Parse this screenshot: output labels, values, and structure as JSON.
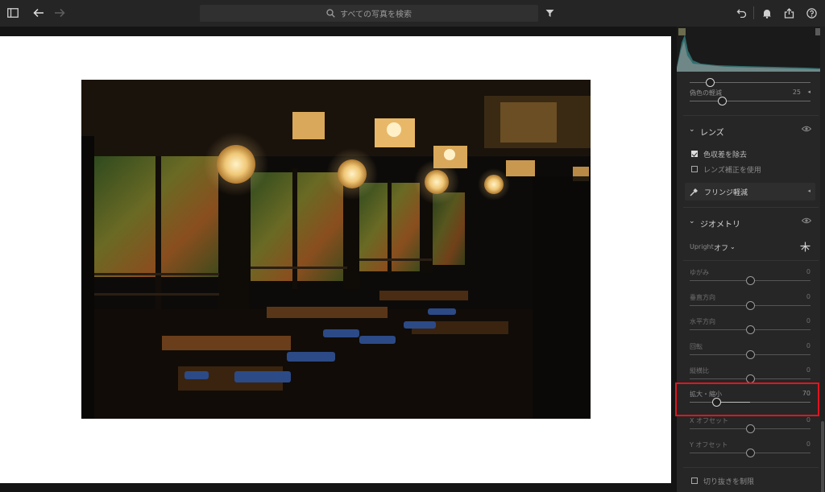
{
  "topbar": {
    "search_placeholder": "すべての写真を検索"
  },
  "panel": {
    "top_slider": {
      "label": "",
      "value": "",
      "level": 0.17
    },
    "defringe_slider": {
      "label": "偽色の軽減",
      "value": "25",
      "level": 0.27
    },
    "lens": {
      "title": "レンズ",
      "remove_ca": {
        "label": "色収差を除去",
        "checked": true
      },
      "enable_profile": {
        "label": "レンズ補正を使用",
        "checked": false
      },
      "fringe_button": {
        "label": "フリンジ軽減"
      }
    },
    "geometry": {
      "title": "ジオメトリ",
      "upright_label": "Upright",
      "upright_value": "オフ",
      "sliders": [
        {
          "label": "ゆがみ",
          "value": "0",
          "level": 0.5
        },
        {
          "label": "垂直方向",
          "value": "0",
          "level": 0.5
        },
        {
          "label": "水平方向",
          "value": "0",
          "level": 0.5
        },
        {
          "label": "回転",
          "value": "0",
          "level": 0.5
        },
        {
          "label": "縦横比",
          "value": "0",
          "level": 0.5
        },
        {
          "label": "拡大・縮小",
          "value": "70",
          "level": 0.22
        },
        {
          "label": "X オフセット",
          "value": "0",
          "level": 0.5
        },
        {
          "label": "Y オフセット",
          "value": "0",
          "level": 0.5
        }
      ],
      "constrain_crop": {
        "label": "切り抜きを制限",
        "checked": false
      }
    }
  },
  "colors": {
    "highlight": "#e0141f"
  }
}
